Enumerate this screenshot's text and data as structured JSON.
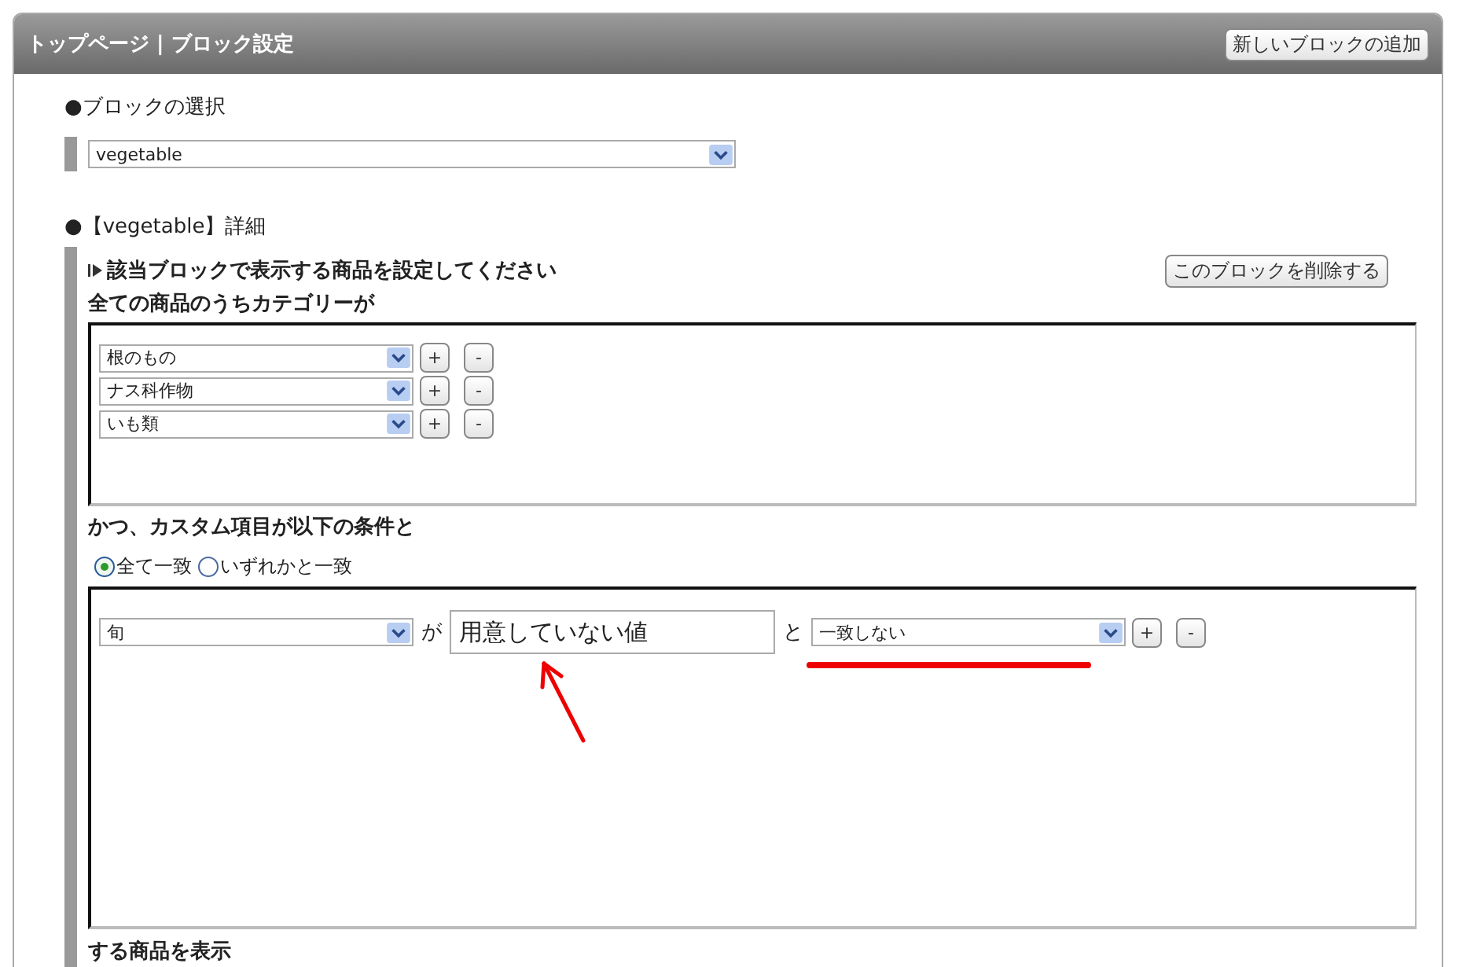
{
  "header": {
    "title": "トップページ | ブロック設定",
    "add_button": "新しいブロックの追加"
  },
  "block_select": {
    "label": "●ブロックの選択",
    "value": "vegetable"
  },
  "detail": {
    "title": "●【vegetable】詳細",
    "instruction": "該当ブロックで表示する商品を設定してください",
    "delete_button": "このブロックを削除する",
    "category_heading": "全ての商品のうちカテゴリーが",
    "categories": [
      {
        "value": "根のもの",
        "add": "+",
        "remove": "-"
      },
      {
        "value": "ナス科作物",
        "add": "+",
        "remove": "-"
      },
      {
        "value": "いも類",
        "add": "+",
        "remove": "-"
      }
    ],
    "custom_heading": "かつ、カスタム項目が以下の条件と",
    "match_options": [
      {
        "label": "全て一致",
        "selected": true
      },
      {
        "label": "いずれかと一致",
        "selected": false
      }
    ],
    "conditions": [
      {
        "field": "旬",
        "connector_1": "が",
        "value": "用意していない値",
        "connector_2": "と",
        "operator": "一致しない",
        "add": "+",
        "remove": "-"
      }
    ],
    "footer_text": "する商品を表示"
  }
}
